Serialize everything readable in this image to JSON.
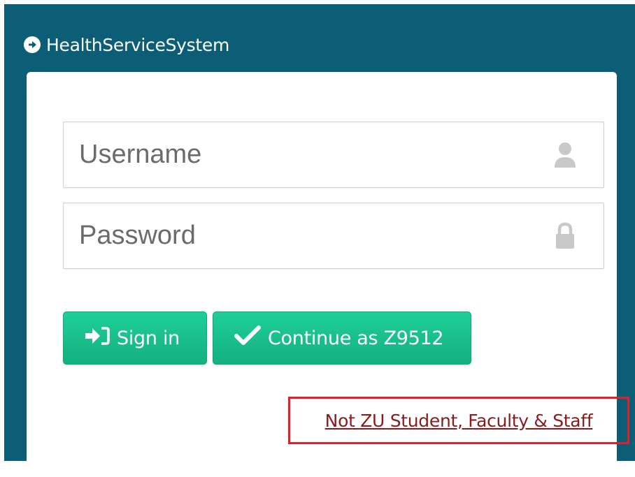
{
  "header": {
    "title": "HealthServiceSystem",
    "icon": "arrow-circle-right-icon"
  },
  "login": {
    "username": {
      "placeholder": "Username",
      "value": "",
      "icon": "user-icon"
    },
    "password": {
      "placeholder": "Password",
      "value": "",
      "icon": "lock-icon"
    },
    "signin_label": "Sign in",
    "signin_icon": "sign-in-icon",
    "continue_label": "Continue as Z9512",
    "continue_icon": "checkmark-icon",
    "external_link": "Not ZU Student, Faculty & Staff"
  },
  "colors": {
    "header_bg": "#0b5e75",
    "button_green": "#1abc8c",
    "link_color": "#8b1a1a",
    "highlight_border": "#e0202a"
  }
}
